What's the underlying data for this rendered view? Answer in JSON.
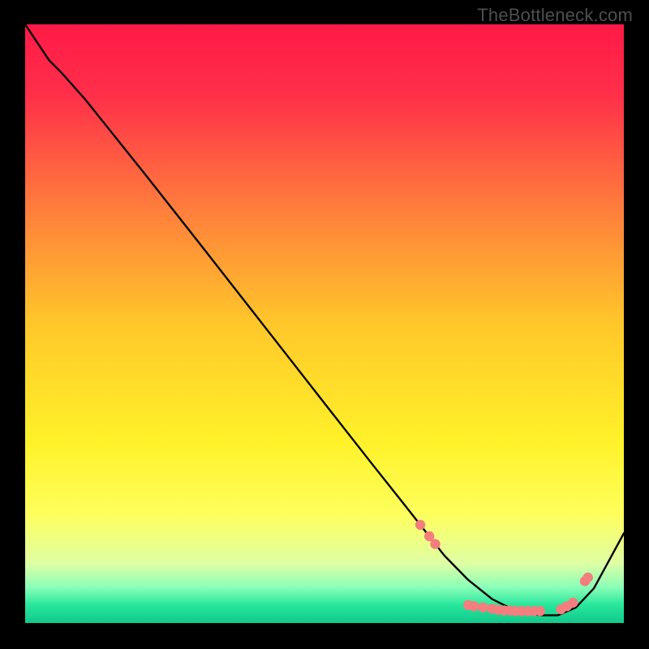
{
  "watermark": "TheBottleneck.com",
  "chart_data": {
    "type": "line",
    "title": "",
    "xlabel": "",
    "ylabel": "",
    "xlim": [
      0,
      100
    ],
    "ylim": [
      0,
      100
    ],
    "background_gradient": {
      "stops": [
        {
          "pos": 0.0,
          "color": "#ff1a46"
        },
        {
          "pos": 0.12,
          "color": "#ff304a"
        },
        {
          "pos": 0.3,
          "color": "#ff7a3d"
        },
        {
          "pos": 0.5,
          "color": "#ffc72a"
        },
        {
          "pos": 0.7,
          "color": "#fff22a"
        },
        {
          "pos": 0.82,
          "color": "#fdff5e"
        },
        {
          "pos": 0.9,
          "color": "#dfffa4"
        },
        {
          "pos": 0.94,
          "color": "#8bffb8"
        },
        {
          "pos": 0.97,
          "color": "#28e69c"
        },
        {
          "pos": 1.0,
          "color": "#11c98c"
        }
      ]
    },
    "curve": {
      "x": [
        0,
        4,
        6,
        10,
        20,
        30,
        40,
        50,
        58,
        63,
        66,
        70,
        74,
        78,
        82,
        86,
        89,
        92,
        95,
        100
      ],
      "y": [
        100,
        94,
        92,
        87.5,
        75,
        62.3,
        49.5,
        36.7,
        26.5,
        20.2,
        16.4,
        11.3,
        7.2,
        4.0,
        2.0,
        1.3,
        1.3,
        2.6,
        5.8,
        15.0
      ]
    },
    "highlight_points": {
      "color": "#f47d7d",
      "radius": 6.2,
      "points": [
        {
          "x": 66.0,
          "y": 16.4
        },
        {
          "x": 67.5,
          "y": 14.5
        },
        {
          "x": 68.5,
          "y": 13.2
        },
        {
          "x": 74.0,
          "y": 3.0
        },
        {
          "x": 75.0,
          "y": 2.8
        },
        {
          "x": 76.5,
          "y": 2.6
        },
        {
          "x": 78.0,
          "y": 2.4
        },
        {
          "x": 79.0,
          "y": 2.2
        },
        {
          "x": 80.0,
          "y": 2.1
        },
        {
          "x": 81.0,
          "y": 2.1
        },
        {
          "x": 82.0,
          "y": 2.0
        },
        {
          "x": 83.0,
          "y": 2.0
        },
        {
          "x": 84.0,
          "y": 2.0
        },
        {
          "x": 85.0,
          "y": 2.0
        },
        {
          "x": 86.0,
          "y": 2.0
        },
        {
          "x": 89.5,
          "y": 2.3
        },
        {
          "x": 90.5,
          "y": 2.8
        },
        {
          "x": 91.5,
          "y": 3.4
        },
        {
          "x": 93.5,
          "y": 7.0
        },
        {
          "x": 94.0,
          "y": 7.6
        }
      ]
    }
  }
}
